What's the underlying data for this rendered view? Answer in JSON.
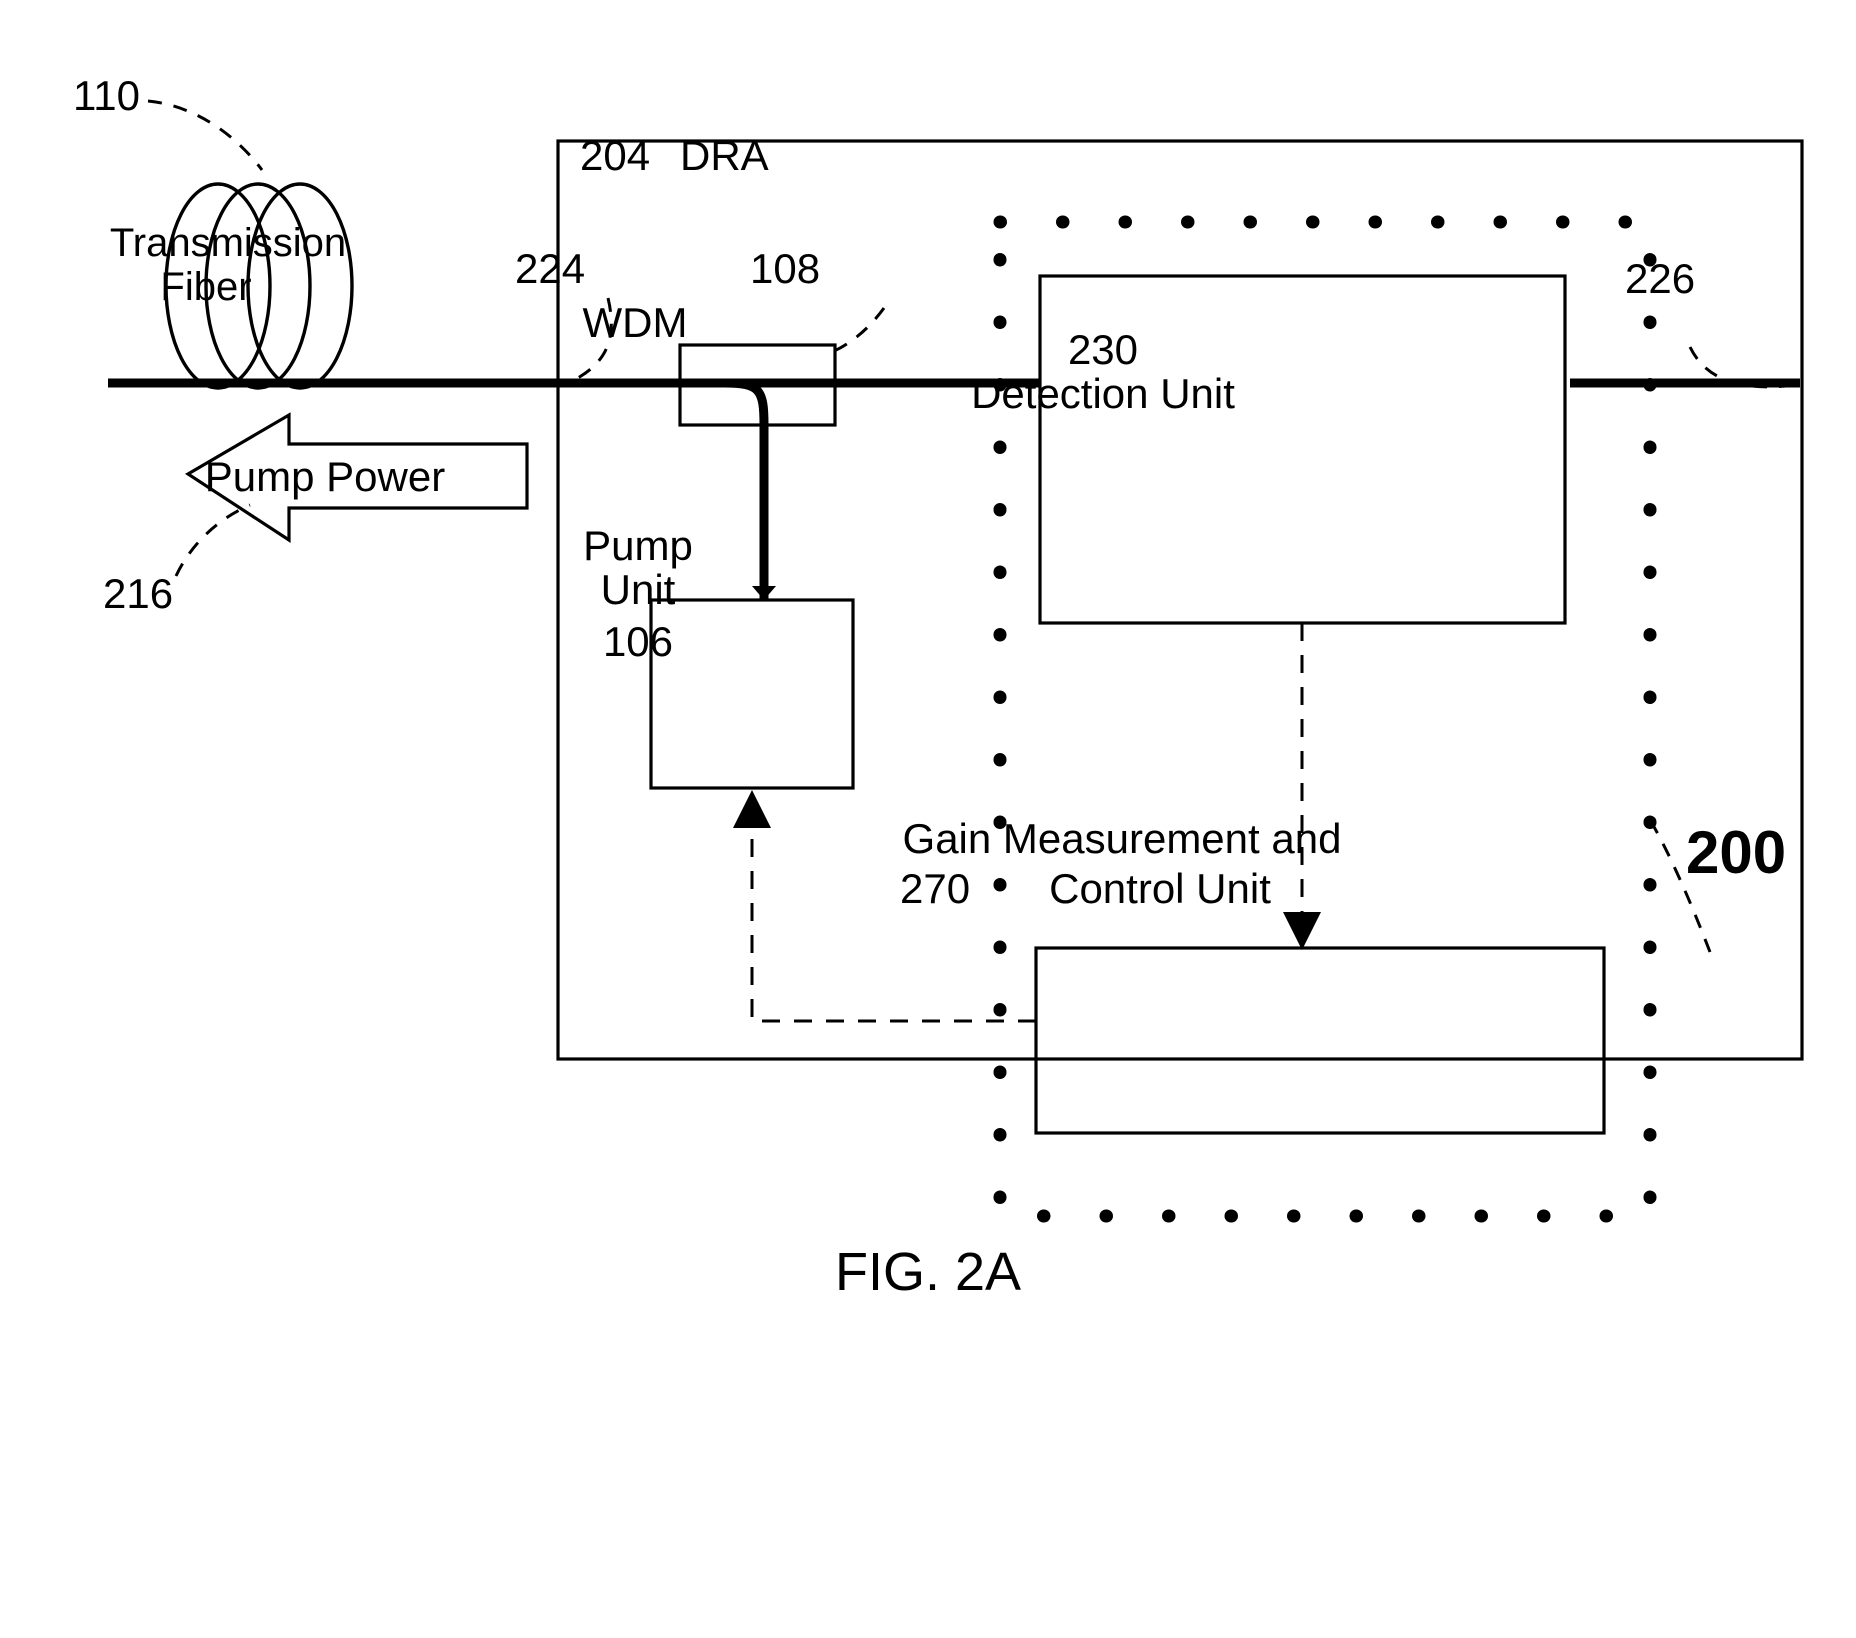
{
  "figure": {
    "caption": "FIG. 2A",
    "overall_ref": "200"
  },
  "transmission_fiber": {
    "ref": "110",
    "label_line1": "Transmission",
    "label_line2": "Fiber"
  },
  "pump_power": {
    "label": "Pump Power",
    "ref": "216"
  },
  "dra": {
    "ref": "204",
    "title": "DRA",
    "input_port_ref": "224",
    "output_port_ref": "226"
  },
  "wdm": {
    "label": "WDM",
    "ref": "108"
  },
  "pump_unit": {
    "label_line1": "Pump",
    "label_line2": "Unit",
    "ref": "106"
  },
  "detection_unit": {
    "ref": "230",
    "label": "Detection Unit"
  },
  "gain_unit": {
    "ref": "270",
    "label_line1": "Gain Measurement and",
    "label_line2": "Control Unit"
  },
  "colors": {
    "ink": "#000000",
    "paper": "#ffffff"
  }
}
